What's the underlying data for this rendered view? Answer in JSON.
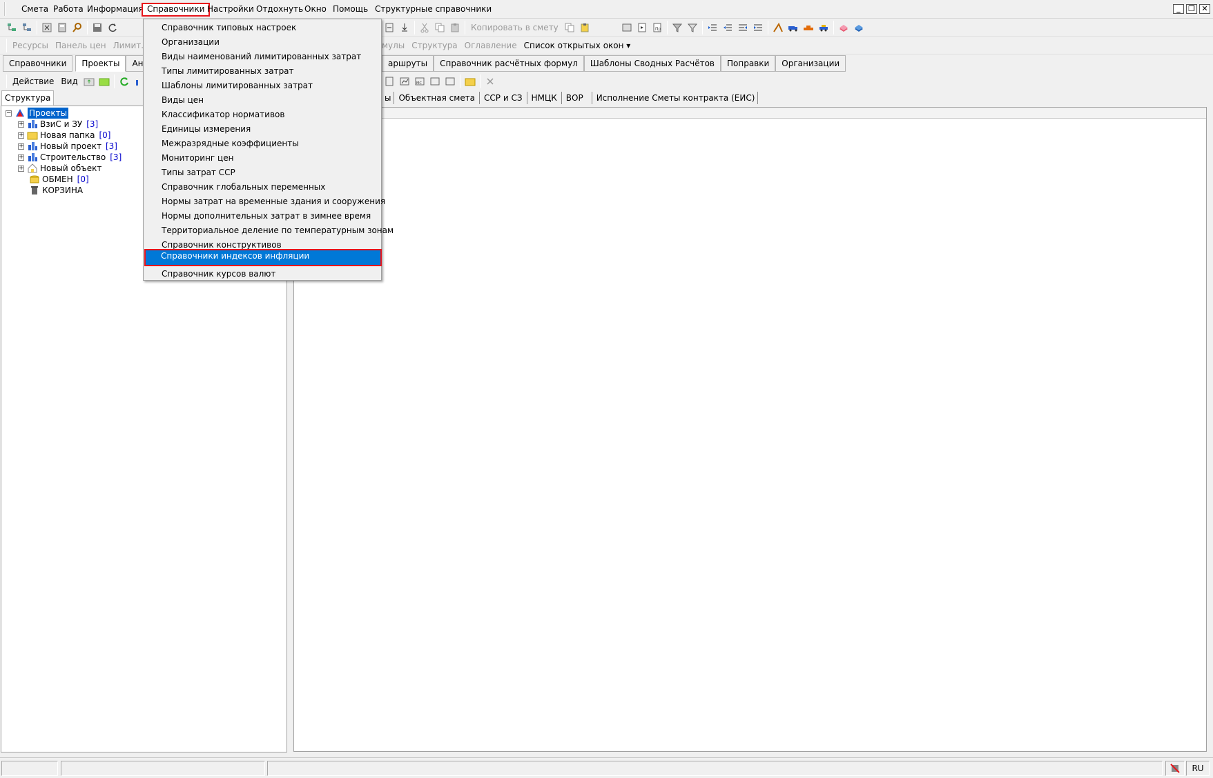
{
  "menubar": {
    "items": [
      "Смета",
      "Работа",
      "Информация",
      "Справочники",
      "Настройки",
      "Отдохнуть",
      "Окно",
      "Помощь",
      "Структурные справочники"
    ]
  },
  "dropdown": {
    "items": [
      "Справочник типовых настроек",
      "Организации",
      "Виды наименований лимитированных затрат",
      "Типы лимитированных затрат",
      "Шаблоны лимитированных затрат",
      "Виды цен",
      "Классификатор нормативов",
      "Единицы измерения",
      "Межразрядные коэффициенты",
      "Мониторинг цен",
      "Типы затрат ССР",
      "Справочник глобальных переменных",
      "Нормы затрат на временные здания и сооружения",
      "Нормы дополнительных затрат в зимнее время",
      "Территориальное деление по температурным зонам",
      "Справочник конструктивов",
      "Справочники индексов инфляции",
      "Справочник курсов валют"
    ],
    "highlighted_index": 16
  },
  "toolbar2": {
    "copy_to_estimate": "Копировать в смету"
  },
  "toolbar3": {
    "left_items": [
      "Ресурсы",
      "Панель цен",
      "Лимит. затр"
    ],
    "right_items": [
      "ормулы",
      "Структура",
      "Оглавление"
    ],
    "open_windows": "Список открытых окон"
  },
  "tabs_row": {
    "left_tabs": [
      "Справочники",
      "Проекты",
      "Аналит"
    ],
    "right_tabs": [
      "аршруты",
      "Справочник расчётных формул",
      "Шаблоны Сводных Расчётов",
      "Поправки",
      "Организации"
    ]
  },
  "action_bar": {
    "action": "Действие",
    "view": "Вид"
  },
  "doc_tabs": {
    "left_fragment": "ы",
    "items": [
      "Объектная смета",
      "ССР и СЗ",
      "НМЦК",
      "ВОР",
      "Исполнение Сметы контракта (ЕИС)"
    ]
  },
  "left_panel": {
    "tab": "Структура",
    "tree": [
      {
        "label": "Проекты",
        "count": "",
        "root": true
      },
      {
        "label": "ВзиС и ЗУ",
        "count": "[3]"
      },
      {
        "label": "Новая папка",
        "count": "[0]"
      },
      {
        "label": "Новый проект",
        "count": "[3]"
      },
      {
        "label": "Строительство",
        "count": "[3]"
      },
      {
        "label": "Новый объект",
        "count": ""
      },
      {
        "label": "ОБМЕН",
        "count": "[0]"
      },
      {
        "label": "КОРЗИНА",
        "count": ""
      }
    ]
  },
  "statusbar": {
    "lang": "RU"
  },
  "colors": {
    "highlight": "#0078d7",
    "annotation": "#e8141a",
    "selection": "#0063cc"
  }
}
